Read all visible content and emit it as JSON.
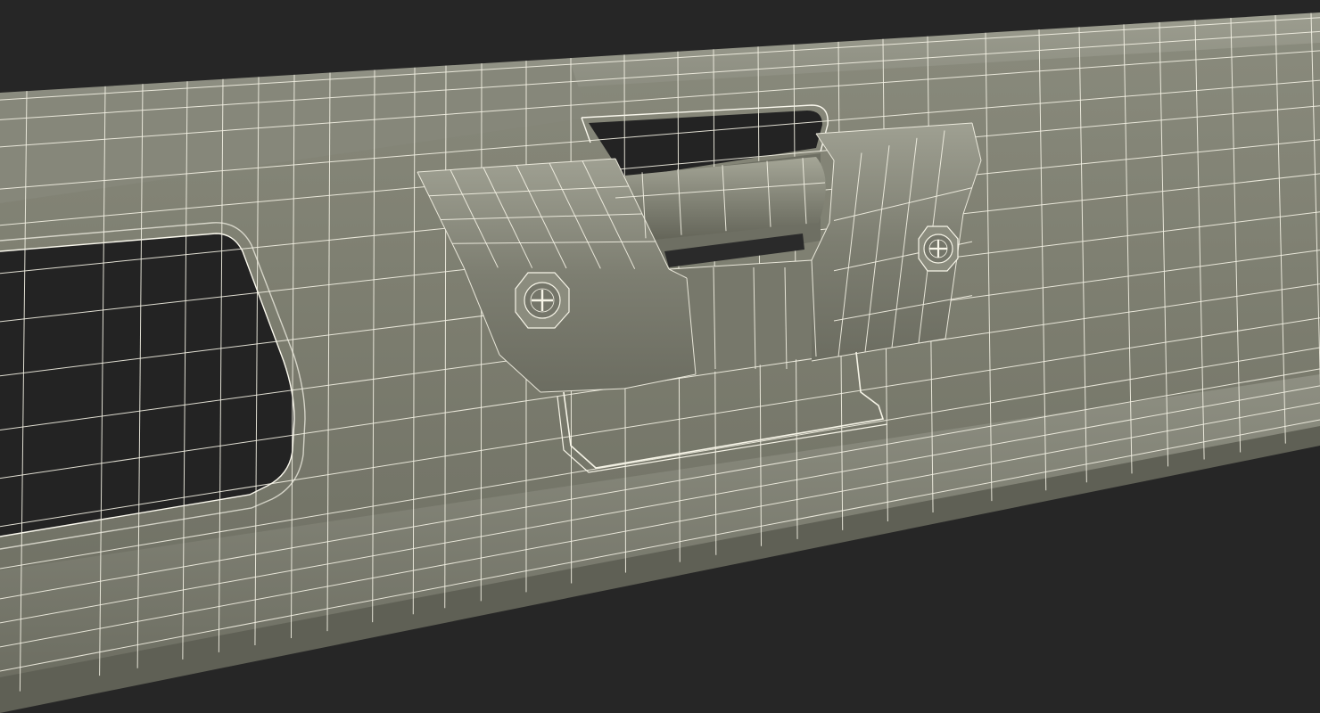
{
  "scene": {
    "subject": "wireframe-3d-render",
    "background_color": "#262626",
    "surface_color": "#7b7c6e",
    "wire_color": "#f4f2e4",
    "hole_color": "#232323"
  }
}
